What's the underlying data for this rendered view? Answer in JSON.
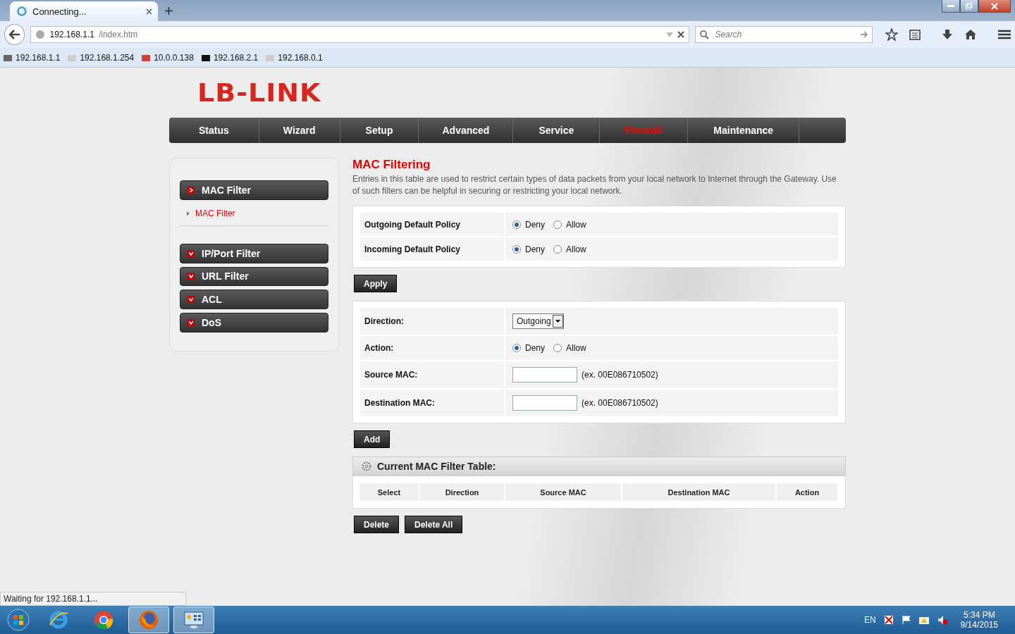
{
  "browser": {
    "tab": {
      "title": "Connecting..."
    },
    "address": {
      "host": "192.168.1.1",
      "path": "/index.htm"
    },
    "search": {
      "placeholder": "Search"
    },
    "bookmarks": [
      "192.168.1.1",
      "192.168.1.254",
      "10.0.0.138",
      "192.168.2.1",
      "192.168.0.1"
    ],
    "status_text": "Waiting for 192.168.1.1..."
  },
  "page": {
    "logo": "LB-LINK",
    "nav": [
      {
        "label": "Status",
        "selected": false
      },
      {
        "label": "Wizard",
        "selected": false
      },
      {
        "label": "Setup",
        "selected": false
      },
      {
        "label": "Advanced",
        "selected": false
      },
      {
        "label": "Service",
        "selected": false
      },
      {
        "label": "Firewall",
        "selected": true
      },
      {
        "label": "Maintenance",
        "selected": false
      }
    ],
    "sidebar": [
      {
        "label": "MAC Filter",
        "expanded": true,
        "children": [
          {
            "label": "MAC Filter",
            "selected": true
          }
        ]
      },
      {
        "label": "IP/Port Filter",
        "expanded": false
      },
      {
        "label": "URL Filter",
        "expanded": false
      },
      {
        "label": "ACL",
        "expanded": false
      },
      {
        "label": "DoS",
        "expanded": false
      }
    ],
    "title": "MAC Filtering",
    "description": "Entries in this table are used to restrict certain types of data packets from your local network to Internet through the Gateway. Use of such filters can be helpful in securing or restricting your local network.",
    "policies": [
      {
        "label": "Outgoing Default Policy",
        "options": [
          {
            "label": "Deny",
            "selected": true
          },
          {
            "label": "Allow",
            "selected": false
          }
        ]
      },
      {
        "label": "Incoming Default Policy",
        "options": [
          {
            "label": "Deny",
            "selected": true
          },
          {
            "label": "Allow",
            "selected": false
          }
        ]
      }
    ],
    "apply_button": "Apply",
    "form": [
      {
        "kind": "select",
        "label": "Direction:",
        "value": "Outgoing"
      },
      {
        "kind": "radio",
        "label": "Action:",
        "options": [
          {
            "label": "Deny",
            "selected": true
          },
          {
            "label": "Allow",
            "selected": false
          }
        ]
      },
      {
        "kind": "input",
        "label": "Source MAC:",
        "hint": "(ex. 00E086710502)"
      },
      {
        "kind": "input",
        "label": "Destination MAC:",
        "hint": "(ex. 00E086710502)"
      }
    ],
    "add_button": "Add",
    "table": {
      "title": "Current MAC Filter Table:",
      "columns": [
        "Select",
        "Direction",
        "Source MAC",
        "Destination MAC",
        "Action"
      ]
    },
    "buttons": [
      "Delete",
      "Delete All"
    ]
  },
  "taskbar": {
    "apps": [
      {
        "kind": "ie",
        "open": false
      },
      {
        "kind": "chrome",
        "open": false
      },
      {
        "kind": "firefox",
        "open": true
      },
      {
        "kind": "panel",
        "open": true
      }
    ],
    "language": "EN",
    "time": "5:34 PM",
    "date": "9/14/2015"
  }
}
